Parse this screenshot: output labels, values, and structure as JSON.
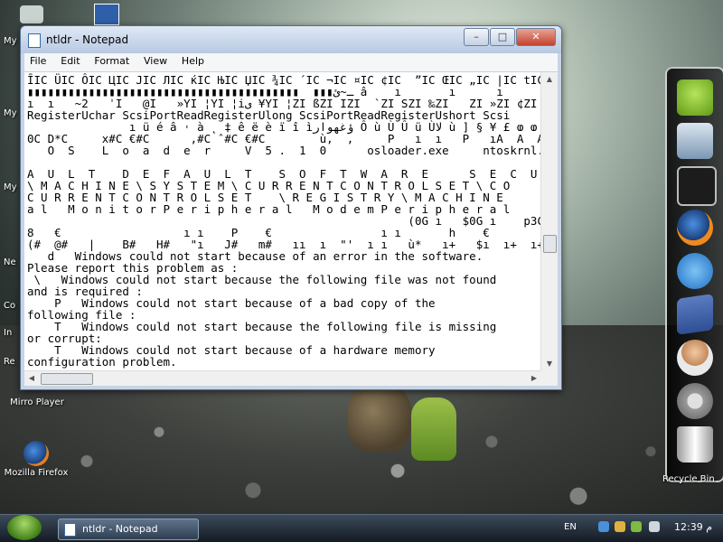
{
  "desktop": {
    "icons": [
      {
        "label": "Mirro Player"
      },
      {
        "label": "Mozilla Firefox"
      }
    ],
    "side_labels": [
      "My",
      "My",
      "My",
      "Ne",
      "Co",
      "In",
      "Re"
    ]
  },
  "window": {
    "title": "ntldr - Notepad",
    "buttons": {
      "minimize": "–",
      "maximize": "□",
      "close": "✕"
    },
    "menu": [
      "File",
      "Edit",
      "Format",
      "View",
      "Help"
    ],
    "content_lines": [
      "ĪIC ÜIC ÔIC ЦIC ЈIC ЛIC ќIC ЊIC ЏIC ¾IC ´IC ¬IC ¤IC ¢IC  ”IC ŒIC „IC |IC tIC  lIC NoMem",
      "▮▮▮▮▮▮▮▮▮▮▮▮▮▮▮▮▮▮▮▮▮▮▮▮▮▮▮▮▮▮▮▮▮▮▮▮▮▮▮▮  ▮▮▮ـ~ئ â    ı       ı      ı      €ہ ے ے",
      "ı  ı   ~2   ˈI   @I   »YI ¦YI ¦iی ¥YI ¦ZI ßZI IZI  `ZI SZI ‰ZI   ZI »ZI ¢ZI ÇZI [[İ[İ *[[",
      "RegisterUchar ScsiPortReadRegisterUlong ScsiPortReadRegisterUshort Scsi",
      "               ı ü é â ˓ à ˛ ‡ ê ë è ï î ìؤغهوار Ô ù Ù Û ü Ùﻻ ù ] § ¥ £ ⱷ ⱷ ⱷضغص ı#",
      "0C D*C     x#C €#C      ‚#C ˆ#C €#C        ù,  ,     P   ı  ı   P   ıA  A  A  ı",
      "   O  S    L  o  a  d  e  r     V  5 .  1  0      osloader.exe     ntoskrnl.exe     ha",
      "",
      "A  U  L  T    D  E  F  A  U  L  T    S  O  F  T  W  A  R  E      S  E  C  U  R  I  T  Y      M  A  C",
      "\\ M A C H I N E \\ S Y S T E M \\ C U R R E N T C O N T R O L S E T \\ C O",
      "C U R R E N T C O N T R O L S E T    \\ R E G I S T R Y \\ M A C H I N E",
      "a l   M o n i t o r P e r i p h e r a l   M o d e m P e r i p h e r a l",
      "                                                        (0G ı   $0G ı    p3C ı    0G",
      "8   €                  ı ı    P    €                ı ı       h    €               ı",
      "(#  @#   |    B#   H#   \"ı   J#   m#   ıı  ı  \"'  ı ı   ù*   ı+   $ı  ı+  ı+  ıı  ù,  ,   ,",
      "   d   Windows could not start because of an error in the software.",
      "Please report this problem as :",
      " \\   Windows could not start because the following file was not found",
      "and is required :",
      "    P   Windows could not start because of a bad copy of the",
      "following file :",
      "    T   Windows could not start because the following file is missing",
      "or corrupt:",
      "    T   Windows could not start because of a hardware memory",
      "configuration problem."
    ]
  },
  "dock": {
    "items": [
      "android-icon",
      "remote-desktop-icon",
      "ipad-icon",
      "firefox-icon",
      "internet-explorer-icon",
      "facebook-icon",
      "support-agent-icon",
      "settings-gear-icon",
      "recycle-bin-icon"
    ],
    "recycle_label": "Recycle Bin"
  },
  "taskbar": {
    "task_label": "ntldr - Notepad",
    "language": "EN",
    "clock": "12:39 م"
  },
  "colors": {
    "accent": "#3b6aa0",
    "dock_bg": "#000000"
  }
}
